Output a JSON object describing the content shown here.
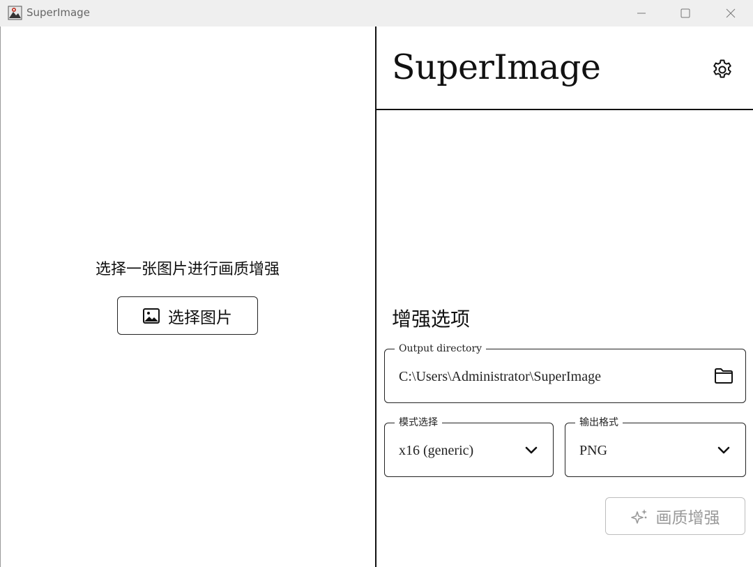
{
  "window": {
    "title": "SuperImage"
  },
  "left": {
    "prompt": "选择一张图片进行画质增强",
    "select_button_label": "选择图片"
  },
  "header": {
    "app_title": "SuperImage",
    "settings_icon": "gear-icon"
  },
  "options": {
    "section_title": "增强选项",
    "output_directory": {
      "label": "Output directory",
      "value": "C:\\Users\\Administrator\\SuperImage"
    },
    "mode": {
      "label": "模式选择",
      "value": "x16 (generic)"
    },
    "format": {
      "label": "输出格式",
      "value": "PNG"
    },
    "enhance_button_label": "画质增强"
  },
  "colors": {
    "accent": "#111111",
    "disabled": "#9a9a9a",
    "titlebar": "#efefef"
  }
}
